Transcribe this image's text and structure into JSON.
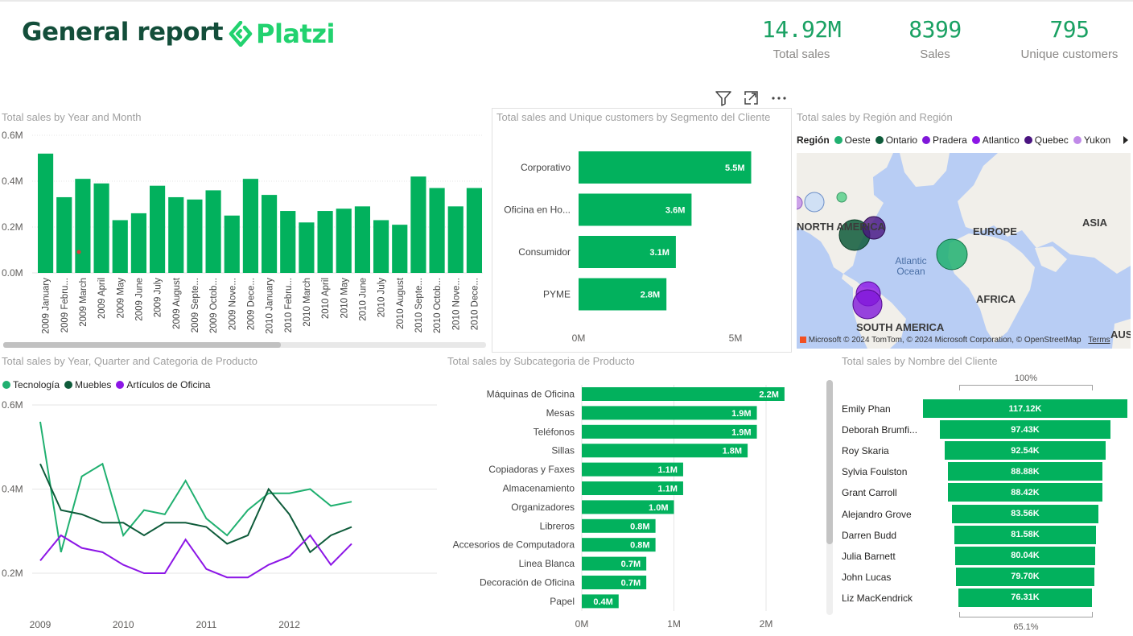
{
  "header": {
    "title": "General report",
    "logo_text": "Platzi",
    "kpis": [
      {
        "value": "14.92M",
        "label": "Total sales"
      },
      {
        "value": "8399",
        "label": "Sales"
      },
      {
        "value": "795",
        "label": "Unique customers"
      }
    ]
  },
  "toolbar": {
    "icons": [
      "filter-icon",
      "focus-mode-icon",
      "more-options-icon"
    ]
  },
  "colors": {
    "green": "#02b15d",
    "darkgreen": "#0e5b3a",
    "purple": "#8c16e6",
    "lightgreen": "#20b070"
  },
  "chart_data": [
    {
      "type": "bar",
      "title": "Total sales by Year and Month",
      "yticks": [
        "0.6M",
        "0.4M",
        "0.2M",
        "0.0M"
      ],
      "ylim": [
        0,
        0.6
      ],
      "categories": [
        "2009 January",
        "2009 Febru...",
        "2009 March",
        "2009 April",
        "2009 May",
        "2009 June",
        "2009 July",
        "2009 August",
        "2009 Septe...",
        "2009 Octob...",
        "2009 Nove...",
        "2009 Dece...",
        "2010 January",
        "2010 Febru...",
        "2010 March",
        "2010 April",
        "2010 May",
        "2010 June",
        "2010 July",
        "2010 August",
        "2010 Septe...",
        "2010 Octob...",
        "2010 Nove...",
        "2010 Dece..."
      ],
      "values": [
        0.52,
        0.33,
        0.41,
        0.39,
        0.23,
        0.26,
        0.38,
        0.33,
        0.32,
        0.36,
        0.25,
        0.41,
        0.34,
        0.27,
        0.22,
        0.27,
        0.28,
        0.29,
        0.23,
        0.21,
        0.42,
        0.37,
        0.29,
        0.37
      ]
    },
    {
      "type": "bar",
      "title": "Total sales and Unique customers by Segmento del Cliente",
      "categories": [
        "Corporativo",
        "Oficina en Ho...",
        "Consumidor",
        "PYME"
      ],
      "values": [
        5.5,
        3.6,
        3.1,
        2.8
      ],
      "labels": [
        "5.5M",
        "3.6M",
        "3.1M",
        "2.8M"
      ],
      "xticks": [
        "0M",
        "5M"
      ]
    },
    {
      "type": "line",
      "title": "Total sales by Year, Quarter and Categoria de Producto",
      "yticks": [
        "0.6M",
        "0.4M",
        "0.2M"
      ],
      "xticks": [
        "2009",
        "2010",
        "2011",
        "2012"
      ],
      "series": [
        {
          "name": "Tecnología",
          "values": [
            0.56,
            0.25,
            0.43,
            0.46,
            0.29,
            0.35,
            0.34,
            0.42,
            0.33,
            0.29,
            0.35,
            0.39,
            0.39,
            0.4,
            0.36,
            0.37
          ]
        },
        {
          "name": "Muebles",
          "values": [
            0.46,
            0.35,
            0.34,
            0.32,
            0.32,
            0.29,
            0.32,
            0.32,
            0.31,
            0.27,
            0.29,
            0.4,
            0.34,
            0.25,
            0.29,
            0.31
          ]
        },
        {
          "name": "Artículos de Oficina",
          "values": [
            0.23,
            0.29,
            0.26,
            0.25,
            0.22,
            0.2,
            0.2,
            0.28,
            0.21,
            0.19,
            0.19,
            0.22,
            0.24,
            0.29,
            0.22,
            0.27
          ]
        }
      ]
    },
    {
      "type": "bar",
      "title": "Total sales by Subcategoria de Producto",
      "categories": [
        "Máquinas de Oficina",
        "Mesas",
        "Teléfonos",
        "Sillas",
        "Copiadoras y Faxes",
        "Almacenamiento",
        "Organizadores",
        "Libreros",
        "Accesorios de Computadora",
        "Linea Blanca",
        "Decoración de Oficina",
        "Papel"
      ],
      "values": [
        2.2,
        1.9,
        1.9,
        1.8,
        1.1,
        1.1,
        1.0,
        0.8,
        0.8,
        0.7,
        0.7,
        0.4
      ],
      "labels": [
        "2.2M",
        "1.9M",
        "1.9M",
        "1.8M",
        "1.1M",
        "1.1M",
        "1.0M",
        "0.8M",
        "0.8M",
        "0.7M",
        "0.7M",
        "0.4M"
      ],
      "xticks": [
        "0M",
        "1M",
        "2M"
      ]
    },
    {
      "type": "bar",
      "title": "Total sales by Nombre del Cliente",
      "top_label": "100%",
      "bottom_label": "65.1%",
      "categories": [
        "Emily Phan",
        "Deborah Brumfi...",
        "Roy Skaria",
        "Sylvia Foulston",
        "Grant Carroll",
        "Alejandro Grove",
        "Darren Budd",
        "Julia Barnett",
        "John Lucas",
        "Liz MacKendrick"
      ],
      "values": [
        117.12,
        97.43,
        92.54,
        88.88,
        88.42,
        83.56,
        81.58,
        80.04,
        79.7,
        76.31
      ],
      "labels": [
        "117.12K",
        "97.43K",
        "92.54K",
        "88.88K",
        "88.42K",
        "83.56K",
        "81.58K",
        "80.04K",
        "79.70K",
        "76.31K"
      ]
    }
  ],
  "map": {
    "title": "Total sales by Región and Región",
    "legend_title": "Región",
    "legend": [
      {
        "name": "Oeste",
        "color": "#20b070"
      },
      {
        "name": "Ontario",
        "color": "#0e5b3a"
      },
      {
        "name": "Pradera",
        "color": "#7f17d9"
      },
      {
        "name": "Atlantico",
        "color": "#8c16e6"
      },
      {
        "name": "Quebec",
        "color": "#4a1480"
      },
      {
        "name": "Yukon",
        "color": "#c08ae8"
      }
    ],
    "labels": {
      "north_america": "NORTH AMERICA",
      "europe": "EUROPE",
      "asia": "ASIA",
      "africa": "AFRICA",
      "south_america": "SOUTH AMERICA",
      "aus": "AUS",
      "ocean": "Atlantic Ocean"
    },
    "attribution": "© 2024 TomTom, © 2024 Microsoft Corporation, © OpenStreetMap",
    "terms": "Terms",
    "brand": "Microsoft"
  }
}
